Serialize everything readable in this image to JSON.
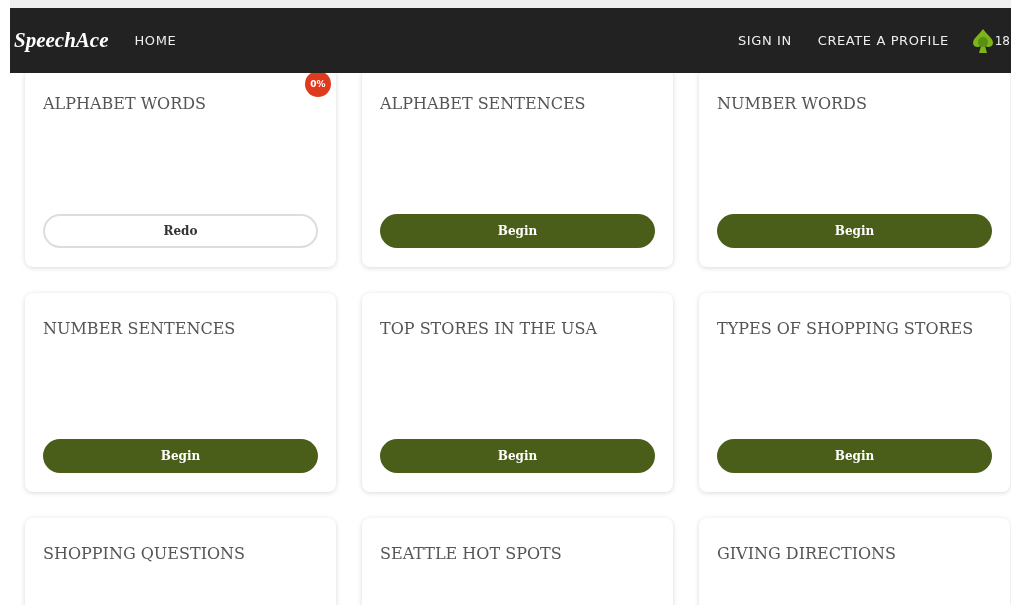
{
  "nav": {
    "logo": "SpeechAce",
    "links": [
      {
        "label": "HOME"
      }
    ],
    "right_links": [
      {
        "label": "SIGN IN"
      },
      {
        "label": "CREATE A PROFILE"
      }
    ],
    "points": "18"
  },
  "cards": [
    {
      "title": "ALPHABET WORDS",
      "badge": "0%",
      "button": {
        "kind": "redo",
        "label": "Redo"
      }
    },
    {
      "title": "ALPHABET SENTENCES",
      "button": {
        "kind": "begin",
        "label": "Begin"
      }
    },
    {
      "title": "NUMBER WORDS",
      "button": {
        "kind": "begin",
        "label": "Begin"
      }
    },
    {
      "title": "NUMBER SENTENCES",
      "button": {
        "kind": "begin",
        "label": "Begin"
      }
    },
    {
      "title": "TOP STORES IN THE USA",
      "button": {
        "kind": "begin",
        "label": "Begin"
      }
    },
    {
      "title": "TYPES OF SHOPPING STORES",
      "button": {
        "kind": "begin",
        "label": "Begin"
      }
    },
    {
      "title": "SHOPPING QUESTIONS"
    },
    {
      "title": "SEATTLE HOT SPOTS"
    },
    {
      "title": "GIVING DIRECTIONS"
    }
  ]
}
